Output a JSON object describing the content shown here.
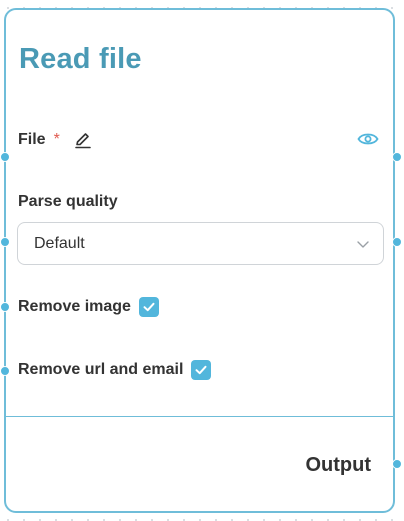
{
  "node": {
    "title": "Read file",
    "file_label": "File",
    "required_mark": "*",
    "parse_quality_label": "Parse quality",
    "parse_quality_value": "Default",
    "remove_image_label": "Remove image",
    "remove_image_checked": true,
    "remove_url_email_label": "Remove url and email",
    "remove_url_email_checked": true,
    "output_label": "Output"
  },
  "colors": {
    "accent": "#52b6dc",
    "title": "#4a9ab5",
    "border": "#6fbdd9",
    "required": "#e05a4f"
  },
  "icons": {
    "edit": "pencil-icon",
    "preview": "eye-icon",
    "dropdown": "chevron-down-icon",
    "checkbox": "checkmark-icon"
  }
}
